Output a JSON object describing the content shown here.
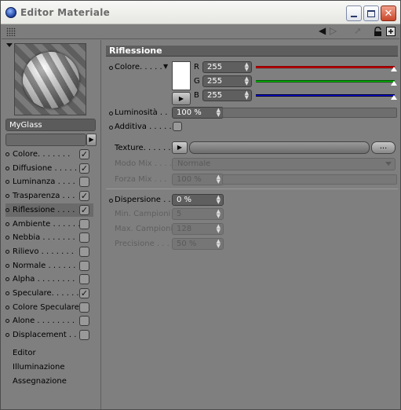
{
  "window": {
    "title": "Editor Materiale",
    "controls": {
      "minimize": "minimize",
      "maximize": "maximize",
      "close": "✕"
    }
  },
  "toolbar": {
    "icons": [
      "back-arrow-icon",
      "forward-arrow-icon",
      "cursor-icon",
      "lock-icon",
      "new-window-icon"
    ]
  },
  "material": {
    "name": "MyGlass",
    "preview_arrow": "▼"
  },
  "channels": [
    {
      "label": "Colore. . . . . . .",
      "checked": true,
      "selected": false
    },
    {
      "label": "Diffusione . . . . .",
      "checked": true,
      "selected": false
    },
    {
      "label": "Luminanza . . . .",
      "checked": false,
      "selected": false
    },
    {
      "label": "Trasparenza . . .",
      "checked": true,
      "selected": false
    },
    {
      "label": "Riflessione . . . .",
      "checked": true,
      "selected": true
    },
    {
      "label": "Ambiente . . . . . .",
      "checked": false,
      "selected": false
    },
    {
      "label": "Nebbia . . . . . . .",
      "checked": false,
      "selected": false
    },
    {
      "label": "Rilievo . . . . . . .",
      "checked": false,
      "selected": false
    },
    {
      "label": "Normale . . . . . .",
      "checked": false,
      "selected": false
    },
    {
      "label": "Alpha . . . . . . . .",
      "checked": false,
      "selected": false
    },
    {
      "label": "Speculare. . . . . .",
      "checked": true,
      "selected": false
    },
    {
      "label": "Colore Speculare",
      "checked": false,
      "selected": false
    },
    {
      "label": "Alone . . . . . . . .",
      "checked": false,
      "selected": false
    },
    {
      "label": "Displacement . . .",
      "checked": false,
      "selected": false
    }
  ],
  "links": [
    "Editor",
    "Illuminazione",
    "Assegnazione"
  ],
  "reflection": {
    "header": "Riflessione",
    "colore_label": "Colore. . . . .",
    "r_label": "R",
    "g_label": "G",
    "b_label": "B",
    "r": "255",
    "g": "255",
    "b": "255",
    "luminosita_label": "Luminosità . .",
    "luminosita": "100 %",
    "additiva_label": "Additiva . . . . .",
    "texture_label": "Texture. . . . . .",
    "texture_dots": "...",
    "modo_mix_label": "Modo Mix . . . .",
    "modo_mix": "Normale",
    "forza_mix_label": "Forza Mix . . .",
    "forza_mix": "100 %",
    "dispersione_label": "Dispersione . .",
    "dispersione": "0 %",
    "min_campioni_label": "Min. Campioni",
    "min_campioni": "5",
    "max_campioni_label": "Max. Campioni",
    "max_campioni": "128",
    "precisione_label": "Precisione . . .",
    "precisione": "50 %"
  },
  "colors": {
    "red": "#e00000",
    "green": "#00c000",
    "blue": "#0000e0"
  }
}
